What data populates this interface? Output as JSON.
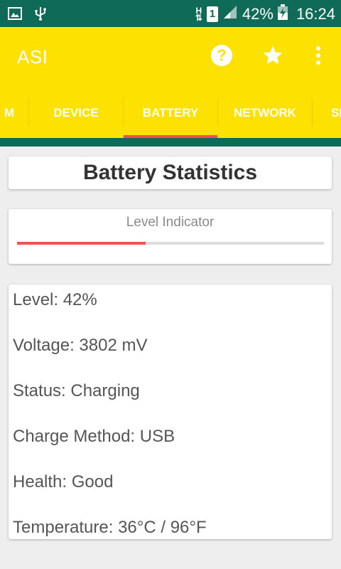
{
  "status_bar": {
    "battery_percent": "42%",
    "time": "16:24",
    "network_type": "H",
    "sim_slot": "1",
    "icons": [
      "image-icon",
      "usb-icon",
      "network-h-icon",
      "sim-1-icon",
      "signal-icon",
      "battery-charging-icon"
    ]
  },
  "app_bar": {
    "title": "ASI",
    "actions": [
      "help-icon",
      "star-icon",
      "more-vert-icon"
    ]
  },
  "tabs": [
    {
      "label": "M"
    },
    {
      "label": "DEVICE"
    },
    {
      "label": "BATTERY"
    },
    {
      "label": "NETWORK"
    },
    {
      "label": "SE"
    }
  ],
  "active_tab": "BATTERY",
  "header_card": {
    "title": "Battery Statistics"
  },
  "level_card": {
    "label": "Level Indicator",
    "level_fraction": 0.42
  },
  "stats": [
    {
      "text": "Level: 42%"
    },
    {
      "text": "Voltage: 3802 mV"
    },
    {
      "text": "Status: Charging"
    },
    {
      "text": "Charge Method: USB"
    },
    {
      "text": "Health: Good"
    },
    {
      "text": "Temperature: 36°C / 96°F"
    }
  ],
  "colors": {
    "toolbar": "#fde100",
    "statusbar": "#0f6b57",
    "accent": "#ef5350"
  }
}
